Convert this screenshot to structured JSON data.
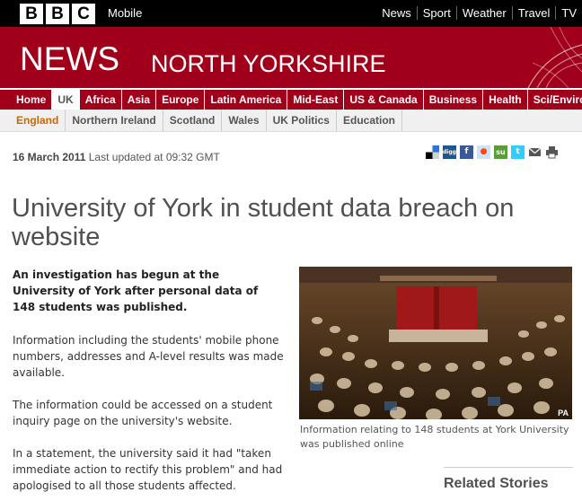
{
  "header": {
    "bbc_letters": [
      "B",
      "B",
      "C"
    ],
    "mobile_label": "Mobile",
    "top_links": [
      "News",
      "Sport",
      "Weather",
      "Travel",
      "TV"
    ]
  },
  "masthead": {
    "news": "NEWS",
    "region": "NORTH YORKSHIRE",
    "color": "#a1001a"
  },
  "nav_primary": {
    "items": [
      "Home",
      "UK",
      "Africa",
      "Asia",
      "Europe",
      "Latin America",
      "Mid-East",
      "US & Canada",
      "Business",
      "Health",
      "Sci/Environment"
    ],
    "active": "UK"
  },
  "nav_secondary": {
    "items": [
      "England",
      "Northern Ireland",
      "Scotland",
      "Wales",
      "UK Politics",
      "Education"
    ],
    "active": "England"
  },
  "article": {
    "date": "16 March 2011",
    "updated": "Last updated at 09:32 GMT",
    "headline": "University of York in student data breach on website",
    "intro": "An investigation has begun at the University of York after personal data of 148 students was published.",
    "paragraphs": [
      "Information including the students' mobile phone numbers, addresses and A-level results was made available.",
      "The information could be accessed on a student inquiry page on the university's website.",
      "In a statement, the university said it had \"taken immediate action to rectify this problem\" and had apologised to all those students affected."
    ],
    "image_credit": "PA",
    "image_caption": "Information relating to 148 students at York University was published online"
  },
  "share_icons": [
    "delicious-icon",
    "digg-icon",
    "facebook-icon",
    "reddit-icon",
    "stumbleupon-icon",
    "twitter-icon",
    "email-icon",
    "print-icon"
  ],
  "sidebar": {
    "related_title": "Related Stories"
  }
}
